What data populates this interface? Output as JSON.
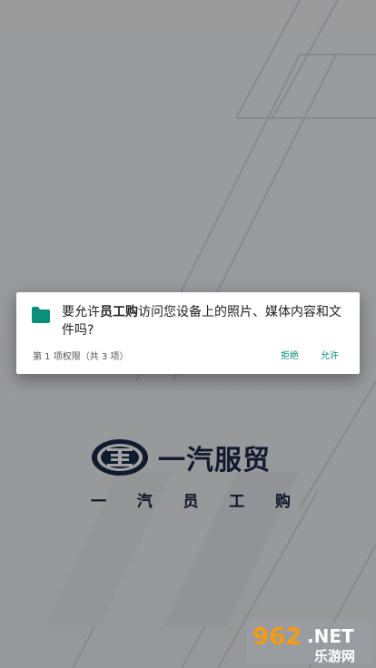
{
  "brand": {
    "title": "一汽服贸",
    "subtitle": [
      "一",
      "汽",
      "员",
      "工",
      "购"
    ]
  },
  "dialog": {
    "message_prefix": "要允许",
    "app_name": "员工购",
    "message_suffix": "访问您设备上的照片、媒体内容和文件吗?",
    "counter": "第 1 项权限（共 3 项）",
    "deny_label": "拒绝",
    "allow_label": "允许",
    "icon": "folder-icon",
    "accent_color": "#0a8f7c"
  },
  "watermark": {
    "number": "962",
    "suffix": ".NET",
    "caption": "乐游网"
  }
}
